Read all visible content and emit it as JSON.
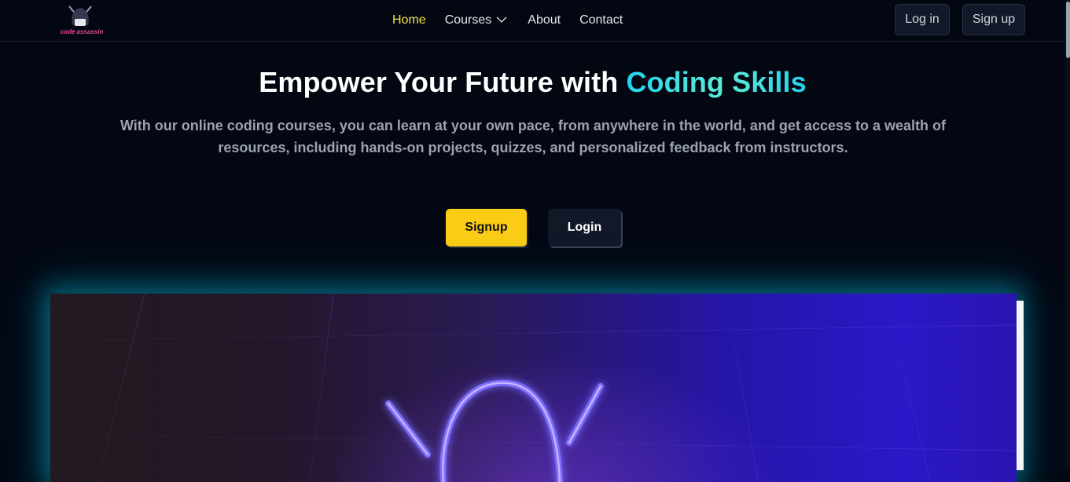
{
  "logo": {
    "text": "code assassin"
  },
  "nav": {
    "links": [
      {
        "label": "Home",
        "active": true
      },
      {
        "label": "Courses",
        "has_dropdown": true
      },
      {
        "label": "About"
      },
      {
        "label": "Contact"
      }
    ],
    "login_label": "Log in",
    "signup_label": "Sign up"
  },
  "hero": {
    "title_plain": "Empower Your Future with ",
    "title_highlight": "Coding Skills",
    "subtitle": "With our online coding courses, you can learn at your own pace, from anywhere in the world, and get access to a wealth of resources, including hands-on projects, quizzes, and personalized feedback from instructors.",
    "signup_label": "Signup",
    "login_label": "Login"
  },
  "colors": {
    "accent": "#facc15",
    "highlight": "#22d3ee",
    "background": "#030712"
  }
}
